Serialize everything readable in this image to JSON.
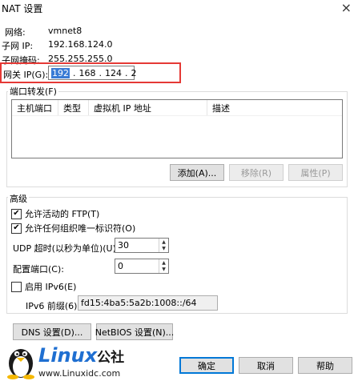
{
  "window": {
    "title": "NAT 设置",
    "close_glyph": "×"
  },
  "network": {
    "label": "网络:",
    "value": "vmnet8"
  },
  "subnet_ip": {
    "label": "子网 IP:",
    "value": "192.168.124.0"
  },
  "subnet_mask": {
    "label": "子网掩码:",
    "value": "255.255.255.0"
  },
  "gateway": {
    "label": "网关 IP(G):",
    "segments": [
      "192",
      "168",
      "124",
      "2"
    ],
    "dot": "."
  },
  "port_forwarding": {
    "title": "端口转发(F)",
    "columns": [
      "主机端口",
      "类型",
      "虚拟机 IP 地址",
      "描述"
    ],
    "add_label": "添加(A)...",
    "remove_label": "移除(R)",
    "properties_label": "属性(P)"
  },
  "advanced": {
    "title": "高级",
    "allow_ftp_label": "允许活动的 FTP(T)",
    "allow_ftp_checked": true,
    "allow_any_oui_label": "允许任何组织唯一标识符(O)",
    "allow_any_oui_checked": true,
    "udp_timeout_label": "UDP 超时(以秒为单位)(U):",
    "udp_timeout_value": "30",
    "config_port_label": "配置端口(C):",
    "config_port_value": "0",
    "enable_ipv6_label": "启用 IPv6(E)",
    "enable_ipv6_checked": false,
    "ipv6_prefix_label": "IPv6 前缀(6):",
    "ipv6_prefix_value": "fd15:4ba5:5a2b:1008::/64"
  },
  "buttons": {
    "dns_label": "DNS 设置(D)...",
    "netbios_label": "NetBIOS 设置(N)...",
    "ok_label": "确定",
    "cancel_label": "取消",
    "help_label": "帮助"
  },
  "watermark": {
    "brand": "Linux",
    "brand_suffix": "公社",
    "url": "www.Linuxidc.com"
  },
  "colors": {
    "highlight_frame": "#e53935",
    "selection": "#3a7bd5",
    "accent": "#0078d7",
    "watermark_blue": "#1f6fd1"
  }
}
